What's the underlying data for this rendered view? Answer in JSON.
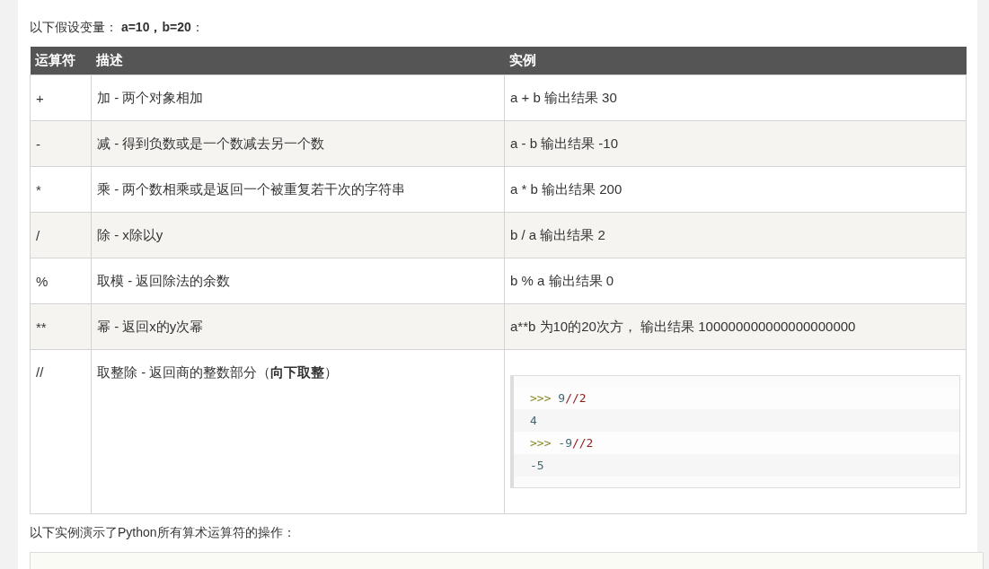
{
  "intro": "以下假设变量： **a=10，b=20**：",
  "table": {
    "columns": [
      "运算符",
      "描述",
      "实例"
    ],
    "rows": [
      {
        "operator": "+",
        "description": "加 - 两个对象相加",
        "example": {
          "kind": "text",
          "text": "a + b 输出结果 30"
        }
      },
      {
        "operator": "-",
        "description": "减 - 得到负数或是一个数减去另一个数",
        "example": {
          "kind": "text",
          "text": "a - b 输出结果 -10"
        }
      },
      {
        "operator": "*",
        "description": "乘 - 两个数相乘或是返回一个被重复若干次的字符串",
        "example": {
          "kind": "text",
          "text": "a * b 输出结果 200"
        }
      },
      {
        "operator": "/",
        "description": "除 - x除以y",
        "example": {
          "kind": "text",
          "text": "b / a 输出结果 2"
        }
      },
      {
        "operator": "%",
        "description": "取模 - 返回除法的余数",
        "example": {
          "kind": "text",
          "text": "b % a 输出结果 0"
        }
      },
      {
        "operator": "**",
        "description": "幂 - 返回x的y次幂",
        "example": {
          "kind": "text",
          "text": "a**b 为10的20次方， 输出结果 100000000000000000000"
        }
      },
      {
        "operator": "//",
        "description": "取整除 - 返回商的整数部分（**向下取整**）",
        "example": {
          "kind": "code",
          "lines": [
            [
              {
                "kind": "prompt",
                "text": ">>>"
              },
              {
                "kind": "number",
                "text": "9"
              },
              {
                "kind": "operator",
                "text": "//2"
              }
            ],
            [
              {
                "kind": "number",
                "text": "4"
              }
            ],
            [
              {
                "kind": "prompt",
                "text": ">>>"
              },
              {
                "kind": "number",
                "text": "-9"
              },
              {
                "kind": "operator",
                "text": "//2"
              }
            ],
            [
              {
                "kind": "number",
                "text": "-5"
              }
            ]
          ]
        }
      }
    ]
  },
  "outro": "以下实例演示了Python所有算术运算符的操作："
}
